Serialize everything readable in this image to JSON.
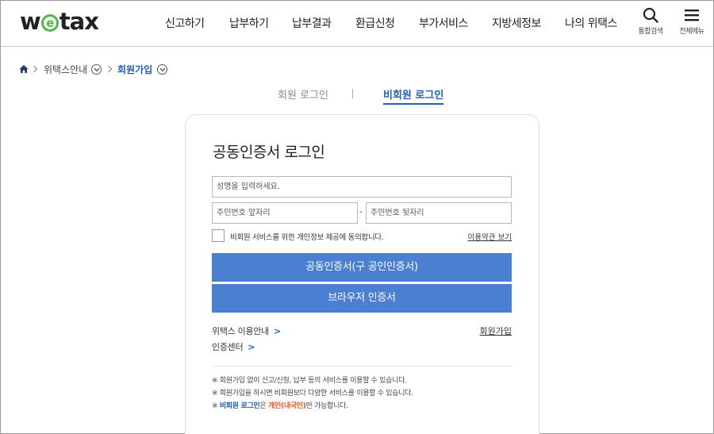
{
  "header": {
    "logo_prefix": "w",
    "logo_e": "e",
    "logo_suffix": "tax",
    "nav": [
      "신고하기",
      "납부하기",
      "납부결과",
      "환급신청",
      "부가서비스",
      "지방세정보",
      "나의 위택스"
    ],
    "search_label": "통합검색",
    "menu_label": "전체메뉴"
  },
  "breadcrumb": {
    "home_icon": "home-icon",
    "level1": "위택스안내",
    "level2": "회원가입"
  },
  "tabs": {
    "member": "회원 로그인",
    "guest": "비회원 로그인",
    "active": "guest"
  },
  "form": {
    "title": "공동인증서 로그인",
    "name_placeholder": "성명을 입력하세요.",
    "id_front_placeholder": "주민번호 앞자리",
    "id_back_placeholder": "주민번호 뒷자리",
    "dash": "-",
    "agree_label": "비회원 서비스를 위한 개인정보 제공에 동의합니다.",
    "terms_link": "이용약관 보기",
    "cert_button": "공동인증서(구 공인인증서)",
    "browser_button": "브라우저 인증서",
    "guide_link": "위택스 이용안내",
    "cert_center_link": "인증센터",
    "join_link": "회원가입",
    "arrow": ">"
  },
  "notes": {
    "mark": "※",
    "line1": "회원가입 없이 신고/신청, 납부 등의 서비스를 이용할 수 있습니다.",
    "line2": "회원가입을 하시면 비회원보다 다양한 서비스를 이용할 수 있습니다.",
    "line3_a": "비회원 로그인",
    "line3_b": "은 ",
    "line3_c": "개인(내국인)",
    "line3_d": "만 가능합니다."
  },
  "colors": {
    "accent": "#1f5fb6",
    "button": "#4a7fd1",
    "logo_green": "#54b848",
    "highlight": "#e8541d"
  }
}
